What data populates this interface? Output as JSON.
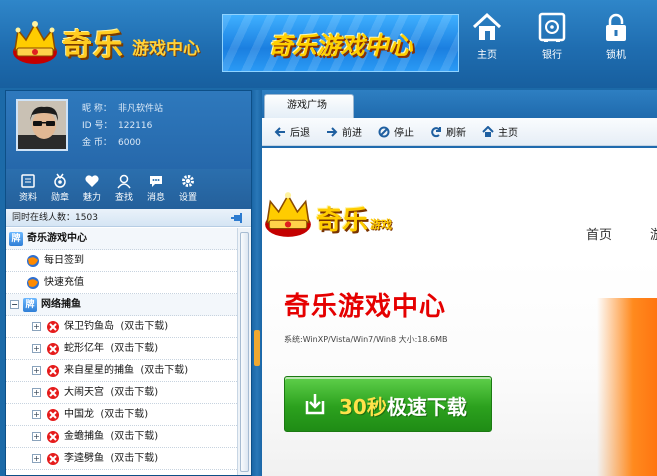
{
  "header": {
    "logo_big": "奇乐",
    "logo_small": "游戏中心",
    "banner_text": "奇乐游戏中心",
    "nav": [
      {
        "label": "主页",
        "icon": "home-icon"
      },
      {
        "label": "银行",
        "icon": "safe-icon"
      },
      {
        "label": "锁机",
        "icon": "lock-icon"
      }
    ]
  },
  "profile": {
    "nickname_label": "昵  称：",
    "nickname": "非凡软件站",
    "id_label": "ID  号：",
    "id": "122116",
    "coins_label": "金  币：",
    "coins": "6000"
  },
  "tools": [
    {
      "label": "资料",
      "icon": "profile-icon"
    },
    {
      "label": "勋章",
      "icon": "medal-icon"
    },
    {
      "label": "魅力",
      "icon": "heart-icon"
    },
    {
      "label": "查找",
      "icon": "find-icon"
    },
    {
      "label": "消息",
      "icon": "message-icon"
    },
    {
      "label": "设置",
      "icon": "gear-icon"
    }
  ],
  "online": {
    "label": "同时在线人数：",
    "count": "1503"
  },
  "tree": {
    "root": "奇乐游戏中心",
    "daily_sign": "每日签到",
    "quick_recharge": "快速充值",
    "group_fishing": "网络捕鱼",
    "hint": "(双击下载)",
    "games": [
      "保卫钓鱼岛",
      "蛇形亿年",
      "来自星星的捕鱼",
      "大闹天宫",
      "中国龙",
      "金蟾捕鱼",
      "李逵劈鱼"
    ]
  },
  "browser": {
    "tab_label": "游戏广场",
    "nav": {
      "back": "后退",
      "forward": "前进",
      "stop": "停止",
      "refresh": "刷新",
      "home": "主页"
    }
  },
  "web": {
    "logo_big": "奇乐",
    "logo_small": "游戏",
    "nav_home": "首页",
    "nav_more": "游",
    "hero_title": "奇乐游戏中心",
    "hero_sys": "系统:WinXP/Vista/Win7/Win8 大小:18.6MB",
    "download_fast": "30秒",
    "download_rest": "极速下载"
  },
  "colors": {
    "header_blue": "#1f6db0",
    "accent_gold": "#ffcc22",
    "download_green": "#2ca11e",
    "hero_red": "#e50000"
  }
}
